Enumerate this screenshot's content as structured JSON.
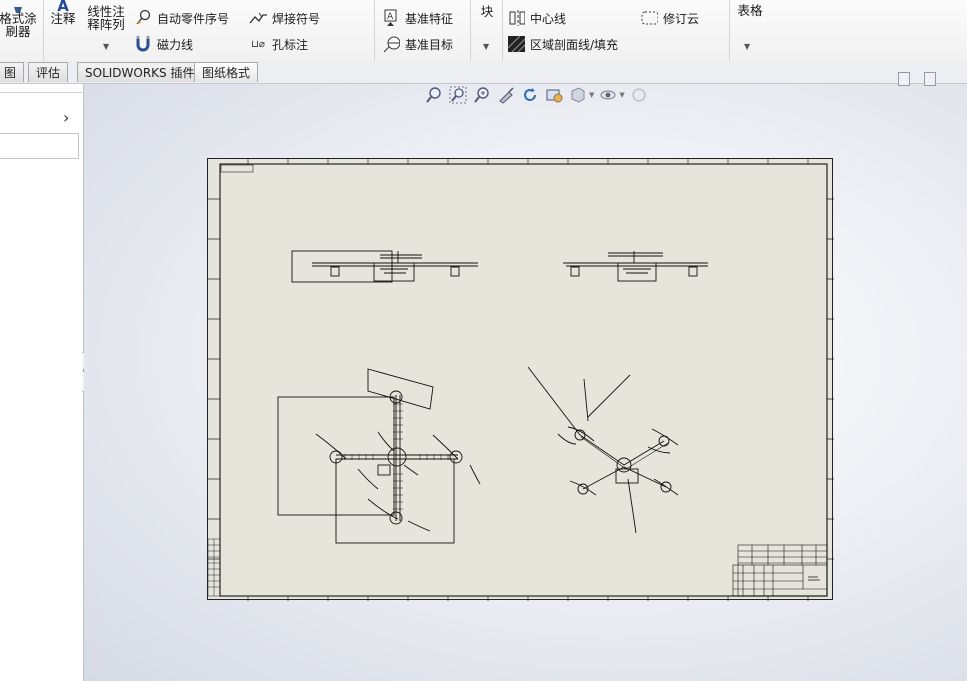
{
  "ribbon": {
    "format_painter": "格式涂\n刷器",
    "note": "注释",
    "linear_pattern": "线性注\n释阵列",
    "auto_balloon": "自动零件序号",
    "magnet_line": "磁力线",
    "weld_symbol": "焊接符号",
    "hole_callout": "孔标注",
    "datum_feature": "基准特征",
    "datum_target": "基准目标",
    "block": "块",
    "centerline": "中心线",
    "area_hatch": "区域剖面线/填充",
    "revision_cloud": "修订云",
    "table": "表格"
  },
  "tabs": [
    {
      "label": "图"
    },
    {
      "label": "评估"
    },
    {
      "label": "SOLIDWORKS 插件"
    },
    {
      "label": "图纸格式"
    }
  ],
  "view_toolbar": {
    "icons": [
      "zoom-to-fit-icon",
      "zoom-to-area-icon",
      "zoom-in-out-icon",
      "pan-icon",
      "rotate-icon",
      "previous-view-icon",
      "display-style-icon",
      "hide-show-icon",
      "appearance-icon"
    ]
  },
  "colors": {
    "sheet": "#e6e5dc",
    "ribbon_bg": "#f4f4f4",
    "graphics_bg": "#e3e6ee"
  }
}
